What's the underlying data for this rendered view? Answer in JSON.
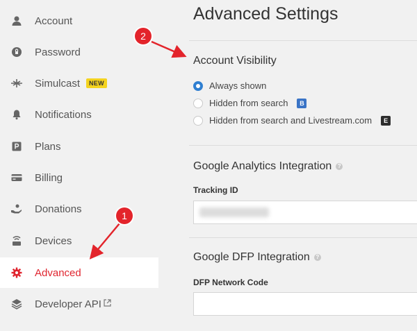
{
  "sidebar": {
    "items": [
      {
        "label": "Account",
        "icon": "user-icon"
      },
      {
        "label": "Password",
        "icon": "lock-icon"
      },
      {
        "label": "Simulcast",
        "icon": "broadcast-icon",
        "badge": "NEW"
      },
      {
        "label": "Notifications",
        "icon": "bell-icon"
      },
      {
        "label": "Plans",
        "icon": "plans-icon"
      },
      {
        "label": "Billing",
        "icon": "credit-card-icon"
      },
      {
        "label": "Donations",
        "icon": "donation-hand-icon"
      },
      {
        "label": "Devices",
        "icon": "device-icon"
      },
      {
        "label": "Advanced",
        "icon": "gear-icon",
        "active": true
      },
      {
        "label": "Developer API",
        "icon": "layers-icon",
        "external": true
      }
    ]
  },
  "main": {
    "title": "Advanced Settings",
    "visibility": {
      "title": "Account Visibility",
      "options": [
        {
          "label": "Always shown",
          "selected": true
        },
        {
          "label": "Hidden from search",
          "tag": "B"
        },
        {
          "label": "Hidden from search and Livestream.com",
          "tag": "E"
        }
      ]
    },
    "analytics": {
      "title": "Google Analytics Integration",
      "field_label": "Tracking ID",
      "value": ""
    },
    "dfp": {
      "title": "Google DFP Integration",
      "field_label": "DFP Network Code",
      "value": ""
    }
  },
  "annotations": {
    "marker1": "1",
    "marker2": "2",
    "color": "#e3242b"
  },
  "colors": {
    "accent": "#e0252f",
    "radio": "#2f7fd1",
    "badge": "#f4d31f"
  }
}
